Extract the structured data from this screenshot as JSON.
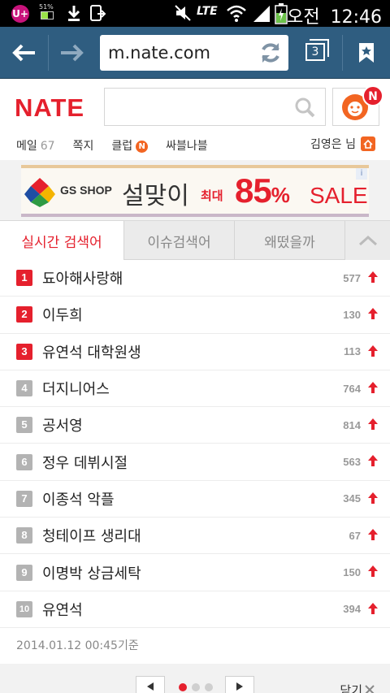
{
  "status_bar": {
    "carrier": "U+",
    "battery_small": "51%",
    "network": "LTE",
    "ampm": "오전",
    "time": "12:46",
    "battery_level": 0.55
  },
  "browser": {
    "url": "m.nate.com",
    "tab_count": "3"
  },
  "header": {
    "logo": "NATE",
    "search_placeholder": "",
    "nateon_badge": "N",
    "menu": [
      {
        "label": "메일",
        "count": "67"
      },
      {
        "label": "쪽지",
        "count": ""
      },
      {
        "label": "클럽",
        "badge": "N"
      },
      {
        "label": "싸블나블"
      }
    ],
    "user": "김영은 님"
  },
  "banner": {
    "brand": "GS SHOP",
    "title": "설맞이",
    "choedae": "최대",
    "percent": "85",
    "percent_sign": "%",
    "sale": "SALE",
    "info": "i"
  },
  "tabs": [
    {
      "label": "실시간 검색어",
      "active": true
    },
    {
      "label": "이슈검색어",
      "active": false
    },
    {
      "label": "왜떴을까",
      "active": false
    }
  ],
  "ranking": [
    {
      "rank": "1",
      "keyword": "됴아해사랑해",
      "count": "577"
    },
    {
      "rank": "2",
      "keyword": "이두희",
      "count": "130"
    },
    {
      "rank": "3",
      "keyword": "유연석 대학원생",
      "count": "113"
    },
    {
      "rank": "4",
      "keyword": "더지니어스",
      "count": "764"
    },
    {
      "rank": "5",
      "keyword": "공서영",
      "count": "814"
    },
    {
      "rank": "6",
      "keyword": "정우 데뷔시절",
      "count": "563"
    },
    {
      "rank": "7",
      "keyword": "이종석 악플",
      "count": "345"
    },
    {
      "rank": "8",
      "keyword": "청테이프 생리대",
      "count": "67"
    },
    {
      "rank": "9",
      "keyword": "이명박 상금세탁",
      "count": "150"
    },
    {
      "rank": "10",
      "keyword": "유연석",
      "count": "394"
    }
  ],
  "timestamp": "2014.01.12 00:45기준",
  "pager": {
    "page_dots": 3,
    "active_dot": 1,
    "close_label": "닫기"
  },
  "colors": {
    "accent": "#e5202d",
    "toolbar": "#2f5d80",
    "nateon": "#f26522"
  }
}
